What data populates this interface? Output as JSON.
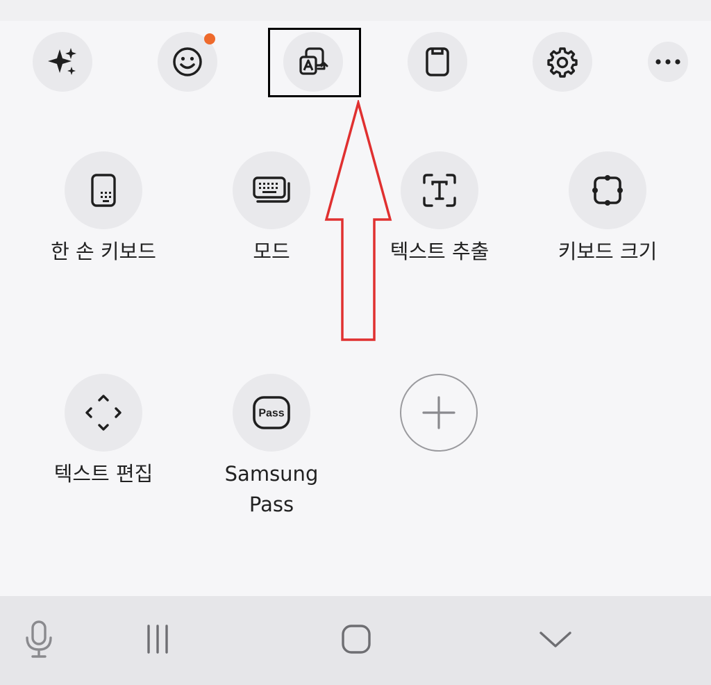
{
  "colors": {
    "background": "#f6f6f8",
    "button_bg": "#e9e9ec",
    "icon": "#1f1f1f",
    "badge": "#ee6a2c",
    "highlight_box": "#000000",
    "arrow": "#e03030",
    "navbar": "#e6e6e9"
  },
  "toolbar": {
    "icons": [
      "sparkle-icon",
      "emoji-icon",
      "translate-icon",
      "clipboard-icon",
      "gear-icon",
      "more-icon"
    ],
    "emoji_badge": true
  },
  "tools": [
    {
      "icon": "one-hand-keyboard-icon",
      "label": "한 손 키보드"
    },
    {
      "icon": "keyboard-mode-icon",
      "label": "모드"
    },
    {
      "icon": "text-extract-icon",
      "label": "텍스트 추출"
    },
    {
      "icon": "keyboard-size-icon",
      "label": "키보드 크기"
    },
    {
      "icon": "text-edit-icon",
      "label": "텍스트 편집"
    },
    {
      "icon": "pass-icon",
      "label": "Samsung\nPass",
      "label_line1": "Samsung",
      "label_line2": "Pass",
      "icon_text": "Pass"
    }
  ],
  "add_button": {
    "icon": "plus-icon"
  },
  "navigation": {
    "icons": [
      "microphone-icon",
      "recent-apps-icon",
      "home-icon",
      "hide-keyboard-icon"
    ]
  }
}
